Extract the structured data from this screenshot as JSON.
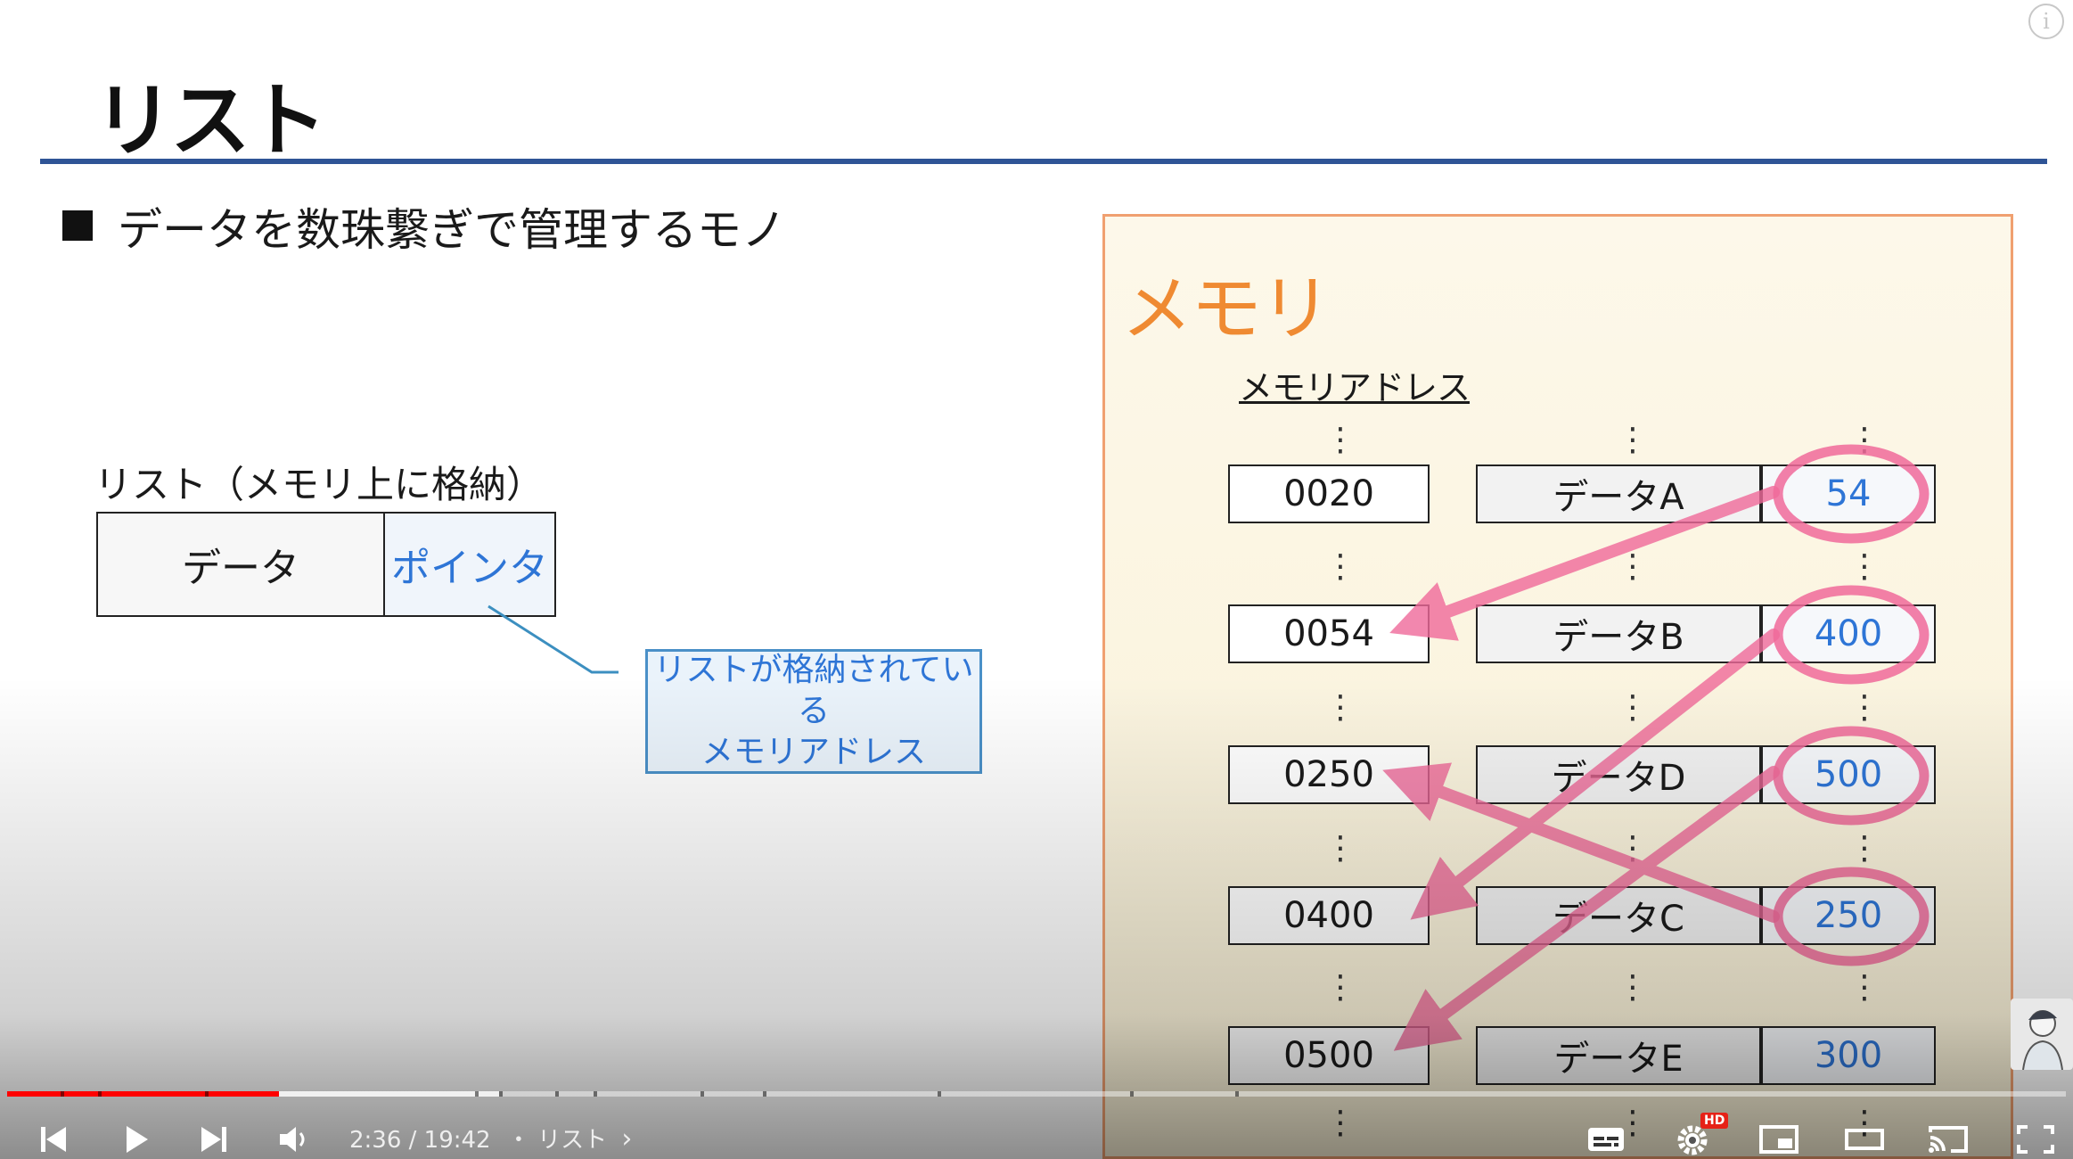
{
  "slide": {
    "title": "リスト",
    "bullet": "データを数珠繋ぎで管理するモノ",
    "list_caption": "リスト（メモリ上に格納）",
    "node": {
      "data_label": "データ",
      "pointer_label": "ポインタ"
    },
    "callout": {
      "line1": "リストが格納されている",
      "line2": "メモリアドレス"
    },
    "memory": {
      "title": "メモリ",
      "address_header": "メモリアドレス",
      "rows": [
        {
          "address": "0020",
          "data": "データA",
          "pointer": "54"
        },
        {
          "address": "0054",
          "data": "データB",
          "pointer": "400"
        },
        {
          "address": "0250",
          "data": "データD",
          "pointer": "500"
        },
        {
          "address": "0400",
          "data": "データC",
          "pointer": "250"
        },
        {
          "address": "0500",
          "data": "データE",
          "pointer": "300"
        }
      ],
      "ellipsis": "⋮"
    },
    "colors": {
      "title_rule": "#2f5496",
      "memory_title": "#ef8a32",
      "pointer_text": "#2e75d6",
      "arrow": "#f06a9a"
    }
  },
  "player": {
    "info_icon": "i",
    "time": "2:36 / 19:42",
    "chapter": "・ リスト",
    "progress_fraction": 0.132,
    "buffered_fraction": 0.239,
    "hd_badge": "HD",
    "icons": [
      "previous-icon",
      "play-icon",
      "next-icon",
      "volume-icon",
      "subtitles-icon",
      "settings-icon",
      "miniplayer-icon",
      "theater-icon",
      "cast-icon",
      "fullscreen-icon"
    ]
  }
}
